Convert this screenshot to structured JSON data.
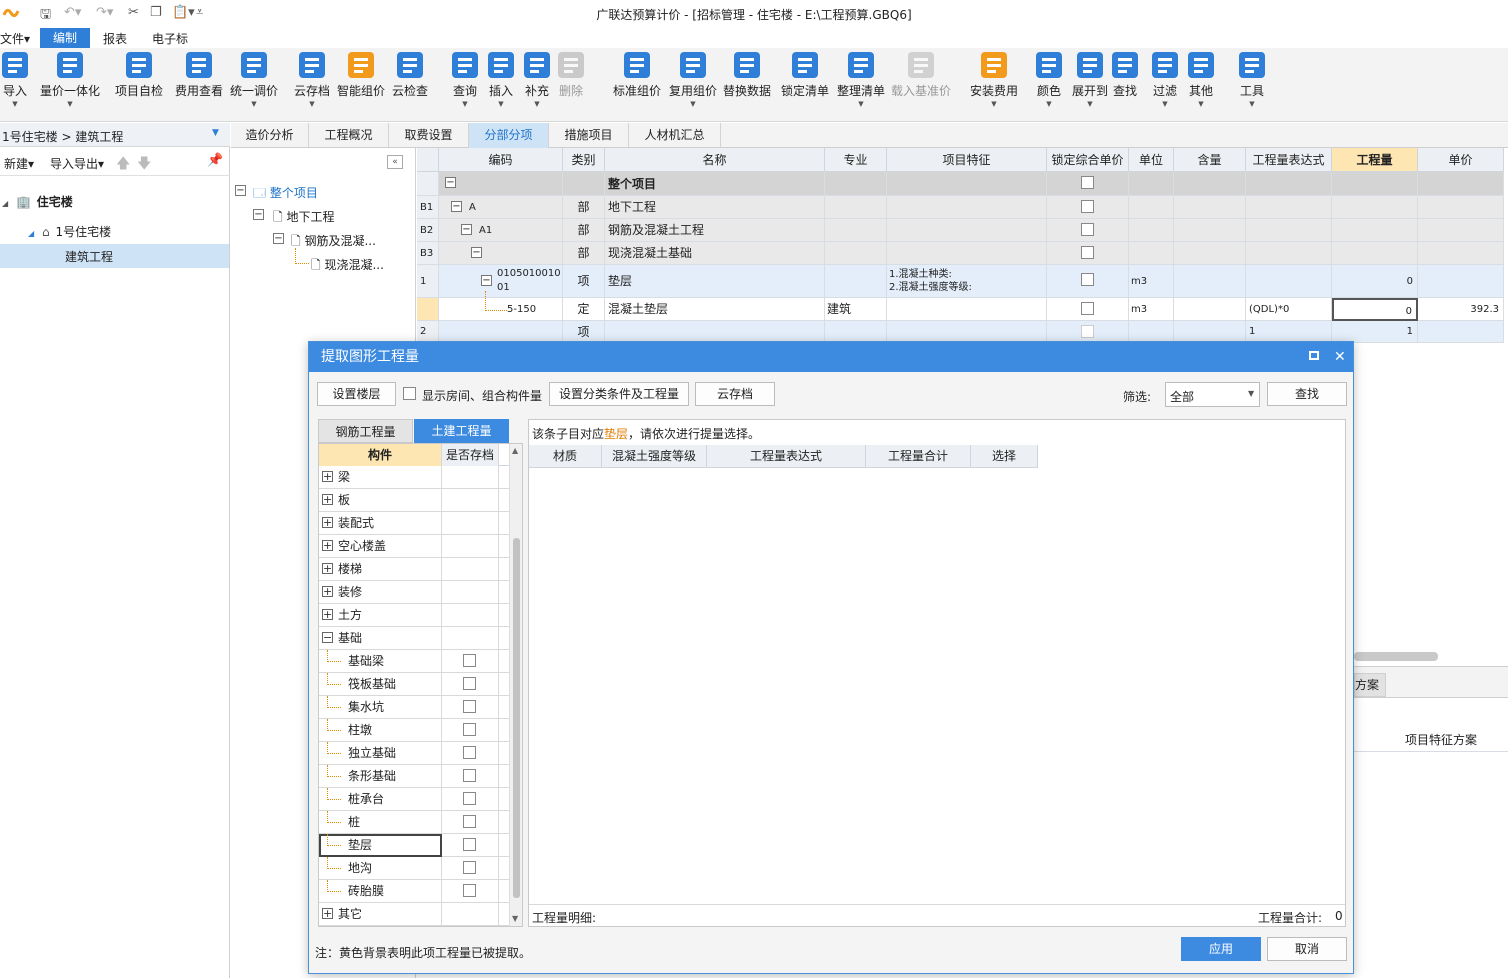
{
  "window": {
    "title": "广联达预算计价 - [招标管理 - 住宅楼 - E:\\工程预算.GBQ6]"
  },
  "menu": {
    "file": "文件",
    "edit": "编制",
    "report": "报表",
    "ebid": "电子标"
  },
  "ribbon": {
    "items": [
      {
        "label": "导入",
        "icon": "import-icon"
      },
      {
        "label": "量价一体化",
        "icon": "quantity-price-icon"
      },
      {
        "label": "项目自检",
        "icon": "self-check-icon"
      },
      {
        "label": "费用查看",
        "icon": "cost-view-icon"
      },
      {
        "label": "统一调价",
        "icon": "price-adjust-icon"
      },
      {
        "label": "云存档",
        "icon": "cloud-save-icon"
      },
      {
        "label": "智能组价",
        "icon": "smart-price-icon"
      },
      {
        "label": "云检查",
        "icon": "cloud-check-icon"
      },
      {
        "label": "查询",
        "icon": "query-icon"
      },
      {
        "label": "插入",
        "icon": "insert-icon"
      },
      {
        "label": "补充",
        "icon": "supplement-icon"
      },
      {
        "label": "删除",
        "icon": "delete-icon"
      },
      {
        "label": "标准组价",
        "icon": "standard-price-icon"
      },
      {
        "label": "复用组价",
        "icon": "reuse-price-icon"
      },
      {
        "label": "替换数据",
        "icon": "replace-data-icon"
      },
      {
        "label": "锁定清单",
        "icon": "lock-list-icon"
      },
      {
        "label": "整理清单",
        "icon": "organize-list-icon"
      },
      {
        "label": "载入基准价",
        "icon": "load-base-price-icon"
      },
      {
        "label": "安装费用",
        "icon": "install-cost-icon"
      },
      {
        "label": "颜色",
        "icon": "color-icon"
      },
      {
        "label": "展开到",
        "icon": "expand-to-icon"
      },
      {
        "label": "查找",
        "icon": "find-icon"
      },
      {
        "label": "过滤",
        "icon": "filter-icon"
      },
      {
        "label": "其他",
        "icon": "other-icon"
      },
      {
        "label": "工具",
        "icon": "tools-icon"
      }
    ]
  },
  "left": {
    "project_path": "1号住宅楼 > 建筑工程",
    "new": "新建",
    "import_export": "导入导出",
    "tree": {
      "root": "住宅楼",
      "building": "1号住宅楼",
      "unit": "建筑工程"
    }
  },
  "mid": {
    "tree": {
      "all": "整个项目",
      "underground": "地下工程",
      "rebar": "钢筋及混凝...",
      "cast": "现浇混凝..."
    }
  },
  "tabs": [
    "造价分析",
    "工程概况",
    "取费设置",
    "分部分项",
    "措施项目",
    "人材机汇总"
  ],
  "grid": {
    "headers": [
      "编码",
      "类别",
      "名称",
      "专业",
      "项目特征",
      "锁定综合单价",
      "单位",
      "含量",
      "工程量表达式",
      "工程量",
      "单价"
    ],
    "rows": [
      {
        "num": "",
        "code": "",
        "type": "",
        "name": "整个项目"
      },
      {
        "num": "B1",
        "code": "A",
        "type": "部",
        "name": "地下工程"
      },
      {
        "num": "B2",
        "code": "A1",
        "type": "部",
        "name": "钢筋及混凝土工程"
      },
      {
        "num": "B3",
        "code": "",
        "type": "部",
        "name": "现浇混凝土基础"
      },
      {
        "num": "1",
        "code": "0105010010 01",
        "type": "项",
        "name": "垫层",
        "feature1": "1.混凝土种类:",
        "feature2": "2.混凝土强度等级:",
        "unit": "m3",
        "qty": "0"
      },
      {
        "num": "",
        "code": "5-150",
        "type": "定",
        "name": "混凝土垫层",
        "spec": "建筑",
        "unit": "m3",
        "expr": "(QDL)*0",
        "qty": "0",
        "price": "392.3"
      },
      {
        "num": "2",
        "code": "",
        "type": "项",
        "name": "",
        "expr": "1",
        "qty": "1"
      }
    ]
  },
  "background_right": {
    "tab_fragment": "方案",
    "label": "项目特征方案"
  },
  "dialog": {
    "title": "提取图形工程量",
    "btn_set_floor": "设置楼层",
    "chk_show_rooms": "显示房间、组合构件量",
    "btn_set_condition": "设置分类条件及工程量",
    "btn_cloud": "云存档",
    "filter_label": "筛选:",
    "filter_value": "全部",
    "btn_find": "查找",
    "tab_rebar": "钢筋工程量",
    "tab_civil": "土建工程量",
    "comp_headers": [
      "构件",
      "是否存档"
    ],
    "components": [
      {
        "name": "梁",
        "group": true
      },
      {
        "name": "板",
        "group": true
      },
      {
        "name": "装配式",
        "group": true
      },
      {
        "name": "空心楼盖",
        "group": true
      },
      {
        "name": "楼梯",
        "group": true
      },
      {
        "name": "装修",
        "group": true
      },
      {
        "name": "土方",
        "group": true
      },
      {
        "name": "基础",
        "group": true,
        "open": true
      },
      {
        "name": "基础梁"
      },
      {
        "name": "筏板基础"
      },
      {
        "name": "集水坑"
      },
      {
        "name": "柱墩"
      },
      {
        "name": "独立基础"
      },
      {
        "name": "条形基础"
      },
      {
        "name": "桩承台"
      },
      {
        "name": "桩"
      },
      {
        "name": "垫层",
        "selected": true
      },
      {
        "name": "地沟"
      },
      {
        "name": "砖胎膜"
      },
      {
        "name": "其它",
        "group": true
      }
    ],
    "hint_prefix": "该条子目对应",
    "hint_highlight": "垫层",
    "hint_suffix": "，请依次进行提量选择。",
    "detail_headers": [
      "材质",
      "混凝土强度等级",
      "工程量表达式",
      "工程量合计",
      "选择"
    ],
    "detail_label": "工程量明细:",
    "total_label": "工程量合计:",
    "total_value": "0",
    "note": "注：黄色背景表明此项工程量已被提取。",
    "btn_apply": "应用",
    "btn_cancel": "取消"
  },
  "colors": {
    "accent": "#3d8be0",
    "highlight_text": "#e07b00",
    "qty_header": "#fde6b2"
  }
}
